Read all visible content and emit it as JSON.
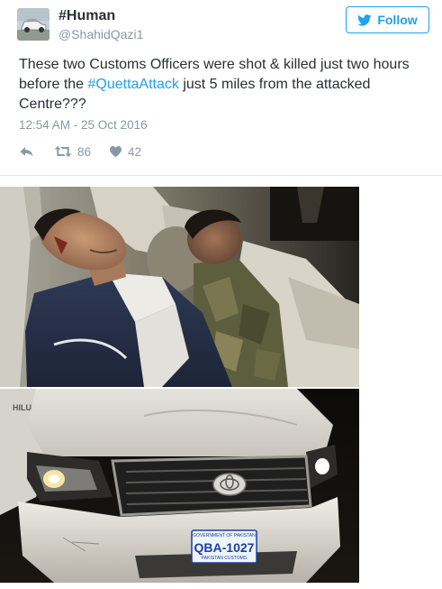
{
  "tweet": {
    "display_name": "#Human",
    "handle": "@ShahidQazi1",
    "follow_label": "Follow",
    "text_before": "These two Customs Officers were shot & killed just two hours before the ",
    "hashtag": "#QuettaAttack",
    "text_after": " just 5 miles from the attacked Centre???",
    "timestamp": "12:54 AM - 25 Oct 2016",
    "retweet_count": "86",
    "like_count": "42"
  },
  "photos": {
    "car": {
      "badge": "HILUX",
      "plate_header": "GOVERNMENT OF PAKISTAN",
      "plate_number": "QBA-1027",
      "plate_footer": "PAKISTAN CUSTOMS"
    }
  },
  "colors": {
    "accent": "#1da1f2",
    "text": "#292f33",
    "muted": "#8899a6"
  },
  "icons": {
    "follow": "twitter-bird-icon",
    "reply": "reply-icon",
    "retweet": "retweet-icon",
    "like": "heart-icon"
  }
}
